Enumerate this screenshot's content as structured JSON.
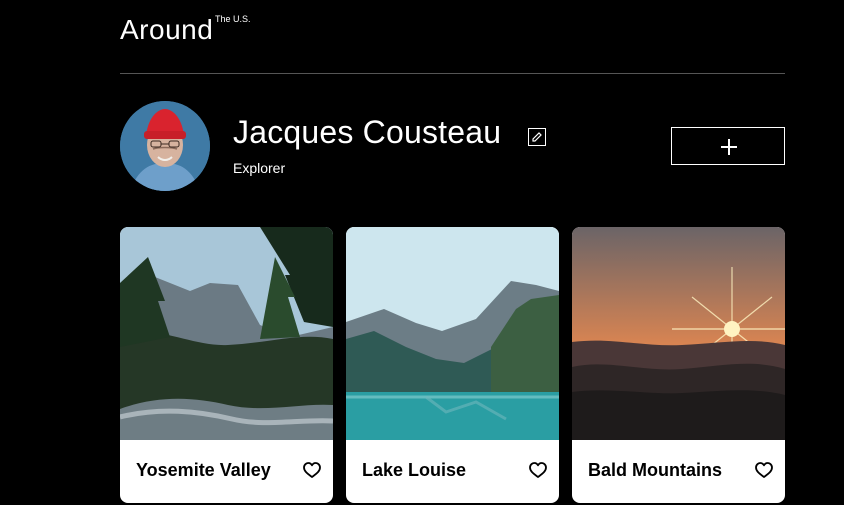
{
  "header": {
    "logo": "Around",
    "logo_sup": "The U.S."
  },
  "profile": {
    "name": "Jacques Cousteau",
    "job": "Explorer",
    "edit_icon": "pencil-icon",
    "add_icon": "plus-icon"
  },
  "cards": [
    {
      "title": "Yosemite Valley",
      "like_icon": "heart-outline-icon"
    },
    {
      "title": "Lake Louise",
      "like_icon": "heart-outline-icon"
    },
    {
      "title": "Bald Mountains",
      "like_icon": "heart-outline-icon"
    }
  ],
  "colors": {
    "background": "#000000",
    "card": "#ffffff",
    "divider": "#555555",
    "text_primary": "#ffffff",
    "card_text": "#000000"
  }
}
